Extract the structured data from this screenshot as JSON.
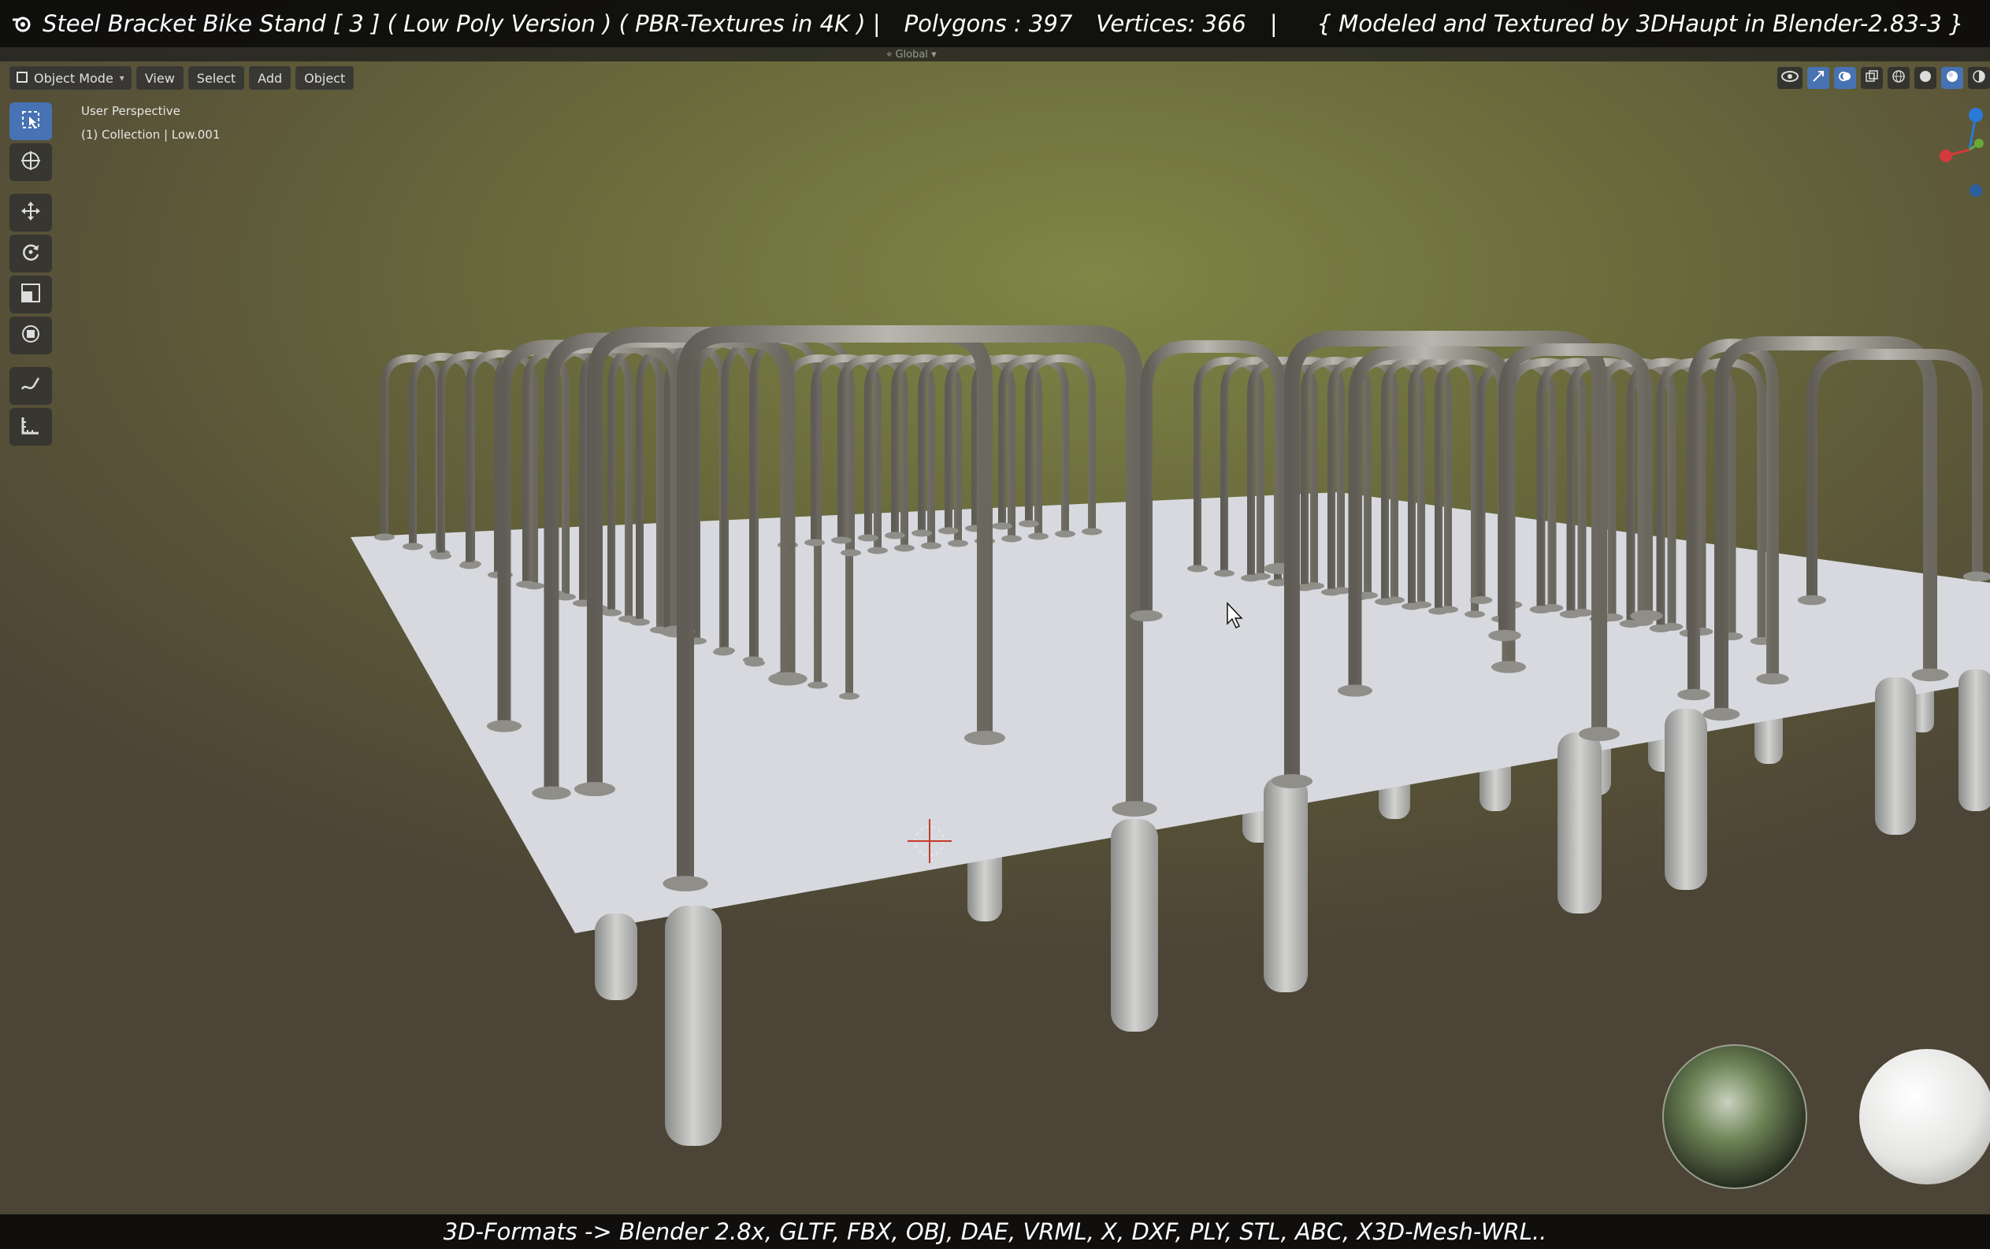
{
  "titlebar": {
    "title": "Steel Bracket Bike Stand [ 3 ] ( Low Poly Version ) ( PBR-Textures in 4K )  |",
    "polygons": "Polygons : 397",
    "vertices": "Vertices: 366",
    "separator": "|",
    "credit": "{ Modeled and Textured by 3DHaupt in Blender-2.83-3 }"
  },
  "header": {
    "orientation_label": "Global"
  },
  "viewport_header": {
    "mode_label": "Object Mode",
    "menu": [
      "View",
      "Select",
      "Add",
      "Object"
    ]
  },
  "viewport_overlay": {
    "perspective": "User Perspective",
    "collection": "(1) Collection | Low.001"
  },
  "toolbar": {
    "tools": [
      {
        "name": "select-box-tool",
        "icon": "select-box-icon",
        "active": true
      },
      {
        "name": "cursor-tool",
        "icon": "cursor-icon",
        "active": false
      },
      {
        "name": "move-tool",
        "icon": "move-icon",
        "active": false
      },
      {
        "name": "rotate-tool",
        "icon": "rotate-icon",
        "active": false
      },
      {
        "name": "scale-tool",
        "icon": "scale-icon",
        "active": false
      },
      {
        "name": "transform-tool",
        "icon": "transform-icon",
        "active": false
      },
      {
        "name": "annotate-tool",
        "icon": "annotate-icon",
        "active": false
      },
      {
        "name": "measure-tool",
        "icon": "measure-icon",
        "active": false
      }
    ]
  },
  "bottom": {
    "formats": "3D-Formats -> Blender 2.8x, GLTF, FBX, OBJ, DAE, VRML, X, DXF, PLY, STL, ABC, X3D-Mesh-WRL.."
  },
  "colors": {
    "accent": "#4772b3",
    "background": "#6c6e3d",
    "plane": "#d7d9de",
    "steel": "#9a9890",
    "concrete": "#b4b6b4"
  }
}
